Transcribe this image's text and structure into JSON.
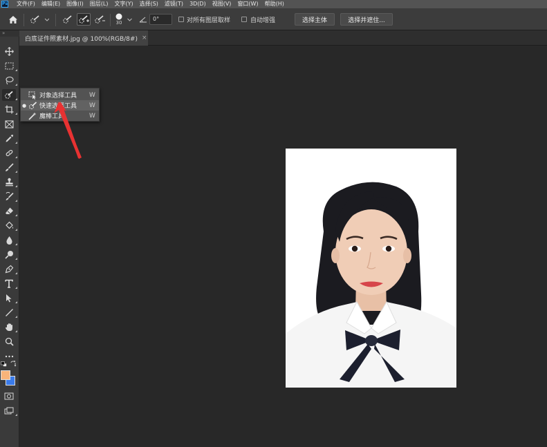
{
  "app": {
    "logo": "Ps"
  },
  "menu": {
    "items": [
      "文件(F)",
      "编辑(E)",
      "图像(I)",
      "图层(L)",
      "文字(Y)",
      "选择(S)",
      "滤镜(T)",
      "3D(D)",
      "视图(V)",
      "窗口(W)",
      "帮助(H)"
    ]
  },
  "options": {
    "brush_size": "30",
    "angle": "0°",
    "sample_all_layers": "对所有图层取样",
    "auto_enhance": "自动增强",
    "select_subject": "选择主体",
    "select_and_mask": "选择并遮住..."
  },
  "panel_toggle": "»",
  "document": {
    "tab_title": "白底证件照素材.jpg @ 100%(RGB/8#)",
    "close": "×"
  },
  "flyout": {
    "items": [
      {
        "label": "对象选择工具",
        "key": "W",
        "selected": false
      },
      {
        "label": "快速选择工具",
        "key": "W",
        "selected": true
      },
      {
        "label": "魔棒工具",
        "key": "W",
        "selected": false
      }
    ]
  },
  "colors": {
    "foreground": "#f8b47a",
    "background": "#3a7bea",
    "annotation": "#e83232",
    "ui_dark": "#282828"
  }
}
